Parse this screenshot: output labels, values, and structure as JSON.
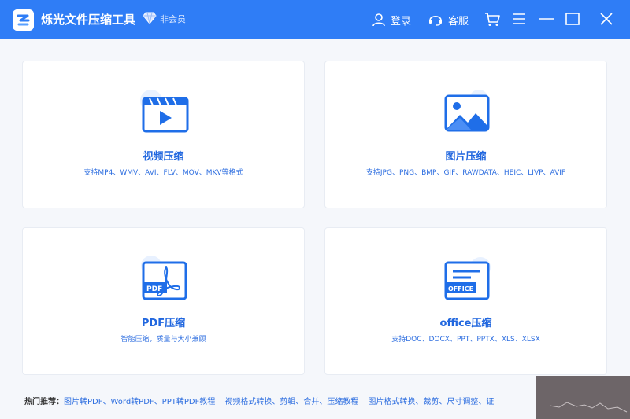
{
  "app": {
    "title": "烁光文件压缩工具",
    "vip_label": "非会员"
  },
  "header": {
    "login_label": "登录",
    "service_label": "客服",
    "icons": [
      "user-icon",
      "headset-icon",
      "cart-icon",
      "menu-icon",
      "minimize-icon",
      "maximize-icon",
      "close-icon"
    ]
  },
  "cards": [
    {
      "title": "视频压缩",
      "subtitle": "支持MP4、WMV、AVI、FLV、MOV、MKV等格式",
      "icon": "video-icon"
    },
    {
      "title": "图片压缩",
      "subtitle": "支持JPG、PNG、BMP、GIF、RAWDATA、HEIC、LIVP、AVIF",
      "icon": "image-icon"
    },
    {
      "title": "PDF压缩",
      "subtitle": "智能压缩，质量与大小兼顾",
      "icon": "pdf-icon"
    },
    {
      "title": "office压缩",
      "subtitle": "支持DOC、DOCX、PPT、PPTX、XLS、XLSX",
      "icon": "office-icon"
    }
  ],
  "hot": {
    "label": "热门推荐：",
    "links": [
      "图片转PDF、Word转PDF、PPT转PDF教程",
      "视频格式转换、剪辑、合并、压缩教程",
      "图片格式转换、裁剪、尺寸调整、证"
    ]
  },
  "colors": {
    "titlebar": "#2f7df6",
    "accent": "#2167df",
    "background": "#f5f7fb"
  }
}
